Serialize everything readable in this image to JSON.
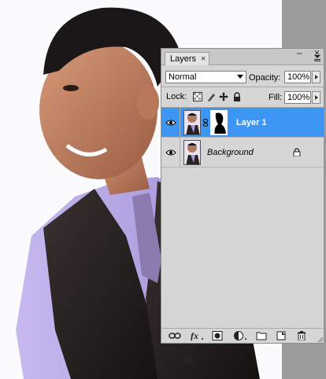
{
  "panel": {
    "tab_label": "Layers",
    "tab_close": "×",
    "minimize": "–",
    "close": "×",
    "blend_mode": "Normal",
    "opacity_label": "Opacity:",
    "opacity_value": "100%",
    "lock_label": "Lock:",
    "fill_label": "Fill:",
    "fill_value": "100%"
  },
  "layers": [
    {
      "name": "Layer 1",
      "selected": true,
      "has_mask": true,
      "visible": true
    },
    {
      "name": "Background",
      "selected": false,
      "has_mask": false,
      "visible": true,
      "locked": true
    }
  ],
  "bottom_icons": [
    "link-layers-icon",
    "fx-icon",
    "add-mask-icon",
    "adjustment-layer-icon",
    "new-group-icon",
    "new-layer-icon",
    "trash-icon"
  ],
  "colors": {
    "selection": "#3d96f4",
    "panel_bg": "#d6d6d6"
  }
}
